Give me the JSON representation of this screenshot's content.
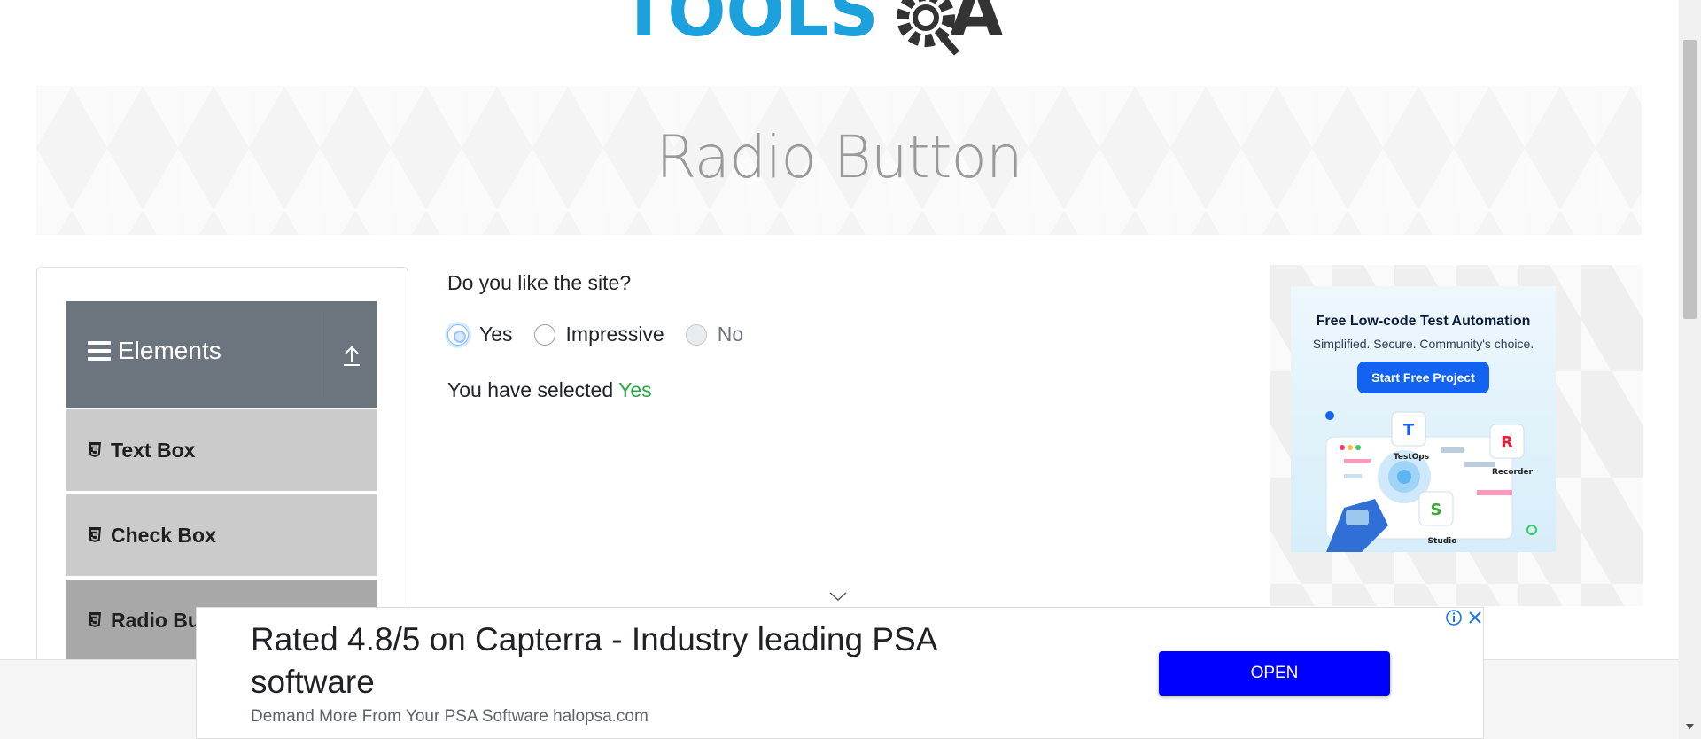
{
  "header": {
    "logo_text_tools": "TOOLS",
    "logo_text_qa": "QA",
    "page_title": "Radio Button"
  },
  "sidebar": {
    "group_title": "Elements",
    "items": [
      {
        "label": "Text Box",
        "active": false
      },
      {
        "label": "Check Box",
        "active": false
      },
      {
        "label": "Radio Bu",
        "active": true
      }
    ]
  },
  "main": {
    "question": "Do you like the site?",
    "options": [
      {
        "label": "Yes",
        "checked": true,
        "disabled": false
      },
      {
        "label": "Impressive",
        "checked": false,
        "disabled": false
      },
      {
        "label": "No",
        "checked": false,
        "disabled": true
      }
    ],
    "selected_prefix": "You have selected",
    "selected_value": "Yes"
  },
  "right_ad": {
    "title": "Free Low-code Test Automation",
    "subtitle": "Simplified. Secure. Community's choice.",
    "button": "Start Free Project",
    "labels": [
      "TestOps",
      "Recorder",
      "Studio"
    ]
  },
  "sticky_ad": {
    "headline": "Rated 4.8/5 on Capterra - Industry leading PSA software",
    "subline": "Demand More From Your PSA Software halopsa.com",
    "open_label": "OPEN"
  },
  "colors": {
    "brand_blue": "#1da1dc",
    "sidebar_header": "#6c757d",
    "selected_green": "#28a745",
    "open_button": "#0000ff"
  }
}
